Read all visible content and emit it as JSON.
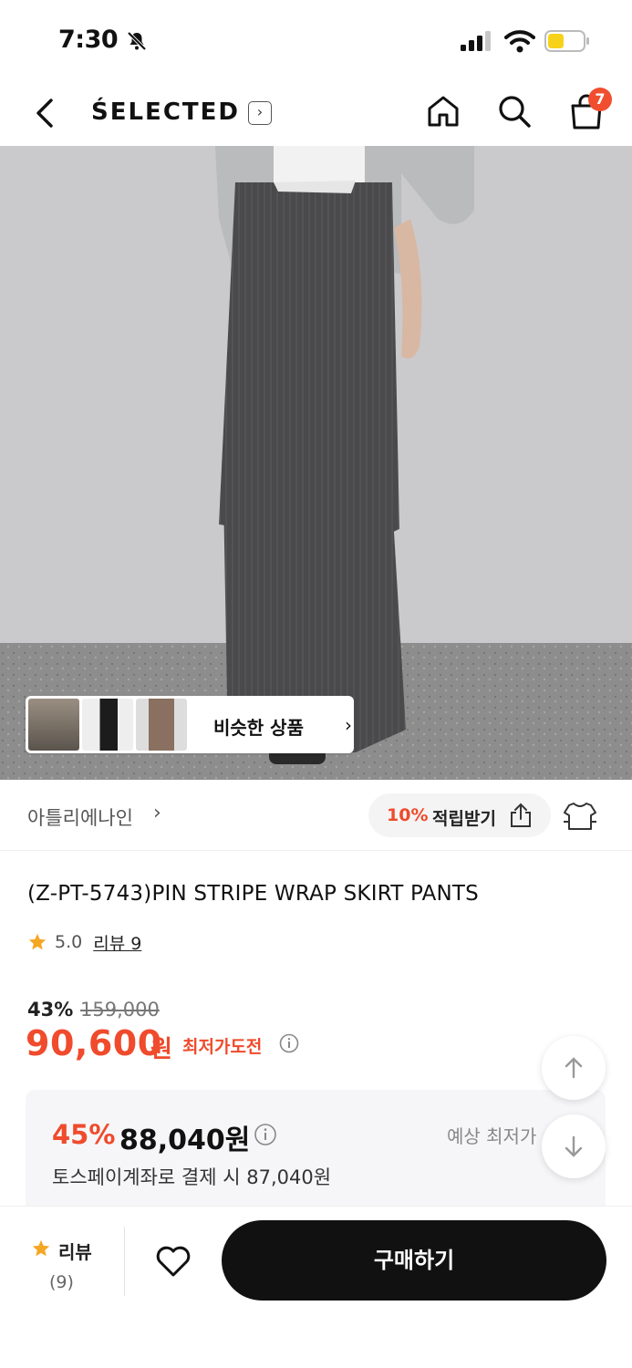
{
  "status_bar": {
    "time": "7:30"
  },
  "header": {
    "brand": "ŚELECTED",
    "cart_count": "7"
  },
  "hero": {
    "similar_label": "비슷한 상품"
  },
  "shop": {
    "name": "아틀리에나인",
    "reward_percent": "10%",
    "reward_label": "적립받기"
  },
  "product": {
    "title": "(Z-PT-5743)PIN STRIPE WRAP SKIRT PANTS",
    "rating": "5.0",
    "review_label": "리뷰 9",
    "discount_rate": "43%",
    "original_price": "159,000",
    "price": "90,600",
    "price_unit": "원",
    "lowest_label": "최저가도전"
  },
  "toss": {
    "discount_rate": "45%",
    "amount": "88,040원",
    "expected_label": "예상 최저가",
    "sub_text": "토스페이계좌로 결제 시 87,040원"
  },
  "bottom_bar": {
    "review_label": "리뷰",
    "review_count": "(9)",
    "buy_label": "구매하기"
  },
  "colors": {
    "accent": "#ef4b2c",
    "star": "#f5a623",
    "buy_button": "#111111"
  }
}
